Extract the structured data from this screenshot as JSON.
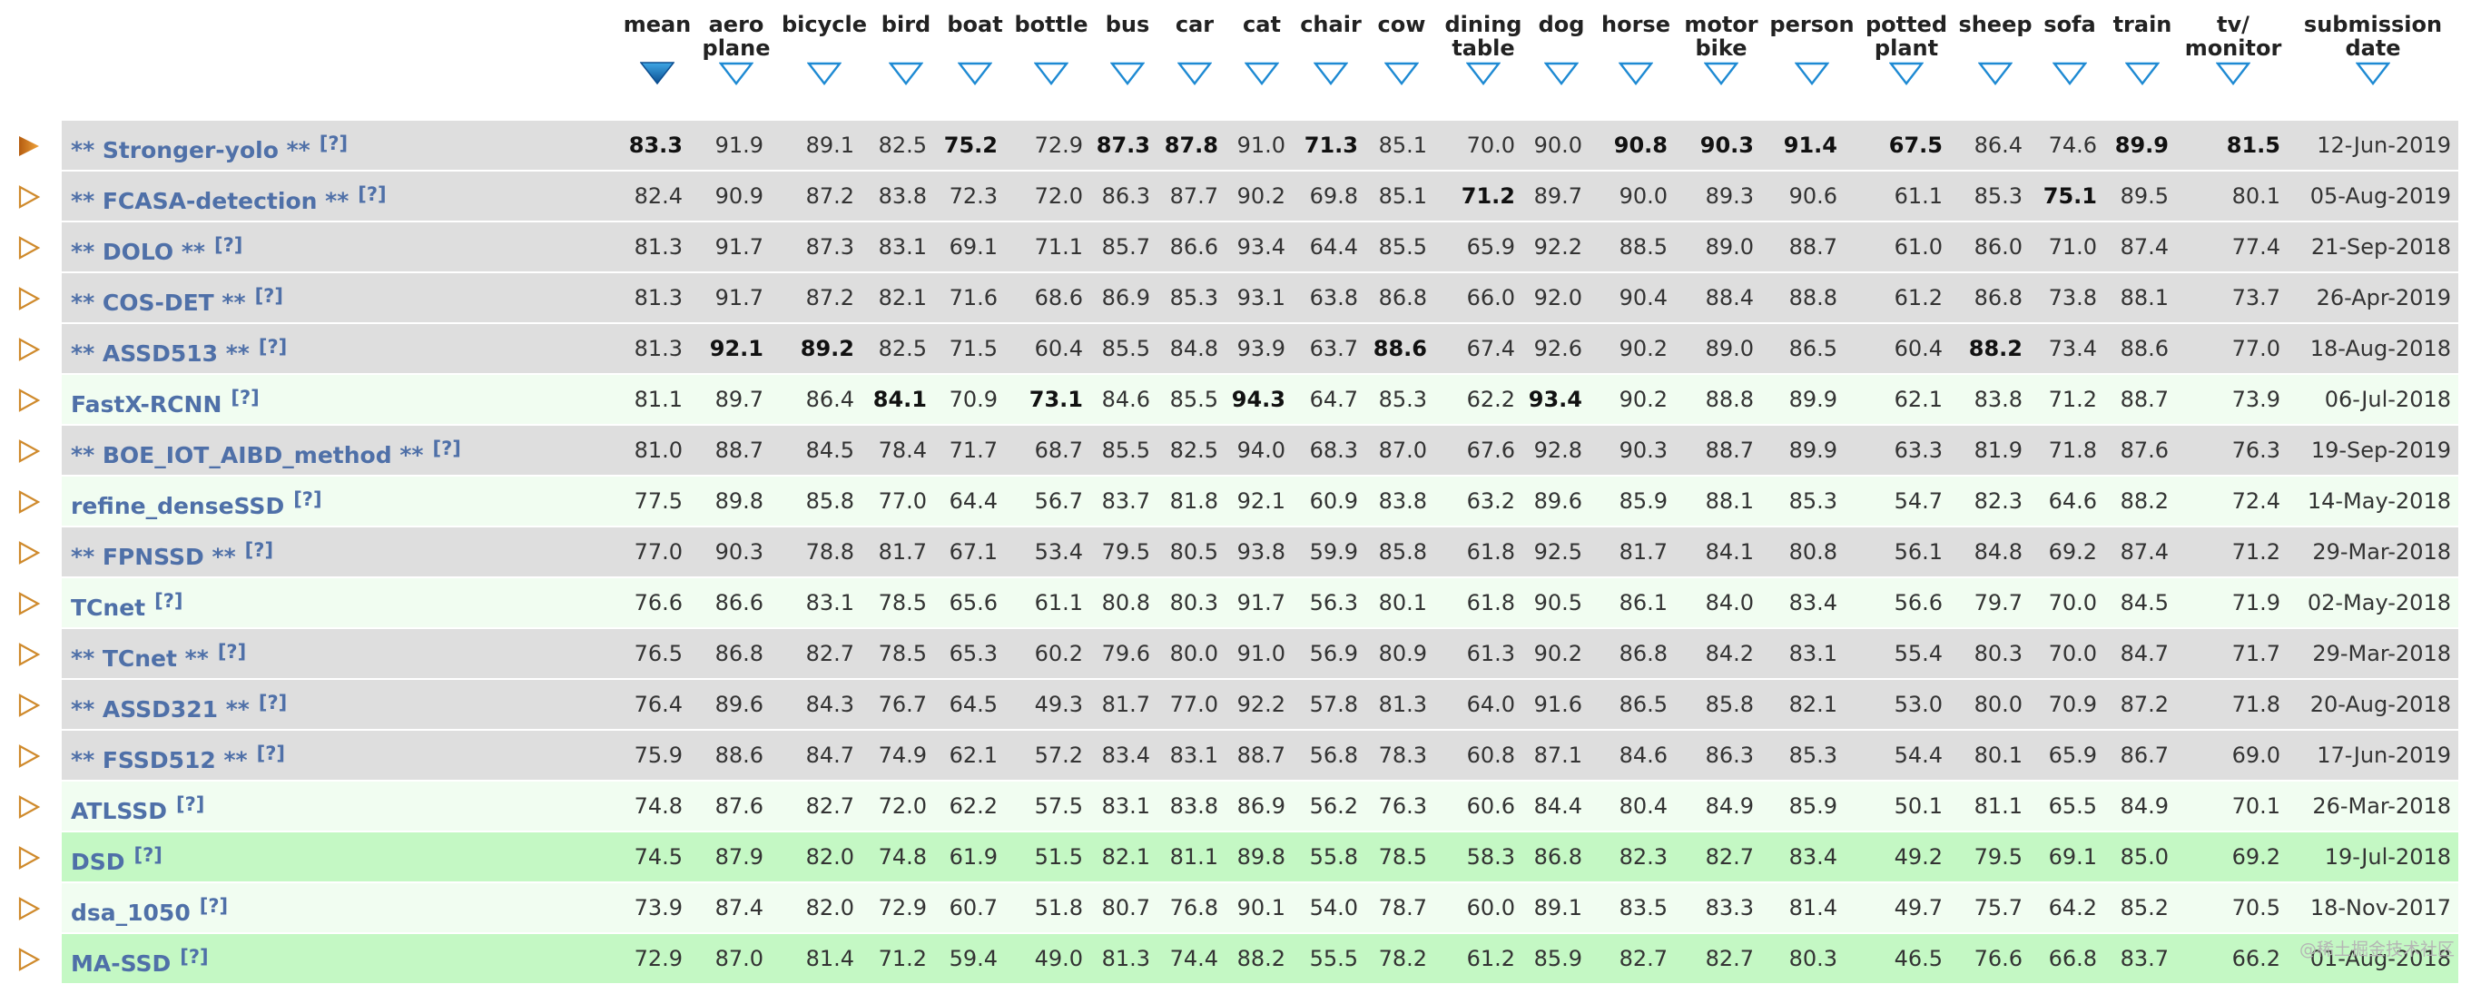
{
  "columns": [
    {
      "key": "mean",
      "label": "mean"
    },
    {
      "key": "aeroplane",
      "label": "aero\nplane"
    },
    {
      "key": "bicycle",
      "label": "bicycle"
    },
    {
      "key": "bird",
      "label": "bird"
    },
    {
      "key": "boat",
      "label": "boat"
    },
    {
      "key": "bottle",
      "label": "bottle"
    },
    {
      "key": "bus",
      "label": "bus"
    },
    {
      "key": "car",
      "label": "car"
    },
    {
      "key": "cat",
      "label": "cat"
    },
    {
      "key": "chair",
      "label": "chair"
    },
    {
      "key": "cow",
      "label": "cow"
    },
    {
      "key": "diningtable",
      "label": "dining\ntable"
    },
    {
      "key": "dog",
      "label": "dog"
    },
    {
      "key": "horse",
      "label": "horse"
    },
    {
      "key": "motorbike",
      "label": "motor\nbike"
    },
    {
      "key": "person",
      "label": "person"
    },
    {
      "key": "pottedplant",
      "label": "potted\nplant"
    },
    {
      "key": "sheep",
      "label": "sheep"
    },
    {
      "key": "sofa",
      "label": "sofa"
    },
    {
      "key": "train",
      "label": "train"
    },
    {
      "key": "tvmonitor",
      "label": "tv/\nmonitor"
    },
    {
      "key": "submission_date",
      "label": "submission\ndate"
    }
  ],
  "sort": {
    "active_column": "mean",
    "direction": "descending"
  },
  "info_link_text": "[?]",
  "colors": {
    "link": "#4f70a8",
    "row_gray": "#dedede",
    "row_pale_green": "#f1fdf1",
    "row_green": "#c4f8c4",
    "arrow_outline": "#1e8ad3",
    "expander_outline": "#cf8a2c",
    "expander_active": "#d07a16"
  },
  "rows": [
    {
      "name": "** Stronger-yolo **",
      "shade": "gray",
      "expanded": true,
      "values": [
        "83.3",
        "91.9",
        "89.1",
        "82.5",
        "75.2",
        "72.9",
        "87.3",
        "87.8",
        "91.0",
        "71.3",
        "85.1",
        "70.0",
        "90.0",
        "90.8",
        "90.3",
        "91.4",
        "67.5",
        "86.4",
        "74.6",
        "89.9",
        "81.5"
      ],
      "best": [
        0,
        4,
        6,
        7,
        9,
        13,
        14,
        15,
        16,
        19,
        20
      ],
      "date": "12-Jun-2019"
    },
    {
      "name": "** FCASA-detection **",
      "shade": "gray",
      "values": [
        "82.4",
        "90.9",
        "87.2",
        "83.8",
        "72.3",
        "72.0",
        "86.3",
        "87.7",
        "90.2",
        "69.8",
        "85.1",
        "71.2",
        "89.7",
        "90.0",
        "89.3",
        "90.6",
        "61.1",
        "85.3",
        "75.1",
        "89.5",
        "80.1"
      ],
      "best": [
        11,
        18
      ],
      "date": "05-Aug-2019"
    },
    {
      "name": "** DOLO **",
      "shade": "gray",
      "values": [
        "81.3",
        "91.7",
        "87.3",
        "83.1",
        "69.1",
        "71.1",
        "85.7",
        "86.6",
        "93.4",
        "64.4",
        "85.5",
        "65.9",
        "92.2",
        "88.5",
        "89.0",
        "88.7",
        "61.0",
        "86.0",
        "71.0",
        "87.4",
        "77.4"
      ],
      "best": [],
      "date": "21-Sep-2018"
    },
    {
      "name": "** COS-DET **",
      "shade": "gray",
      "values": [
        "81.3",
        "91.7",
        "87.2",
        "82.1",
        "71.6",
        "68.6",
        "86.9",
        "85.3",
        "93.1",
        "63.8",
        "86.8",
        "66.0",
        "92.0",
        "90.4",
        "88.4",
        "88.8",
        "61.2",
        "86.8",
        "73.8",
        "88.1",
        "73.7"
      ],
      "best": [],
      "date": "26-Apr-2019"
    },
    {
      "name": "** ASSD513 **",
      "shade": "gray",
      "values": [
        "81.3",
        "92.1",
        "89.2",
        "82.5",
        "71.5",
        "60.4",
        "85.5",
        "84.8",
        "93.9",
        "63.7",
        "88.6",
        "67.4",
        "92.6",
        "90.2",
        "89.0",
        "86.5",
        "60.4",
        "88.2",
        "73.4",
        "88.6",
        "77.0"
      ],
      "best": [
        1,
        2,
        10,
        17
      ],
      "date": "18-Aug-2018"
    },
    {
      "name": "FastX-RCNN",
      "shade": "pale",
      "values": [
        "81.1",
        "89.7",
        "86.4",
        "84.1",
        "70.9",
        "73.1",
        "84.6",
        "85.5",
        "94.3",
        "64.7",
        "85.3",
        "62.2",
        "93.4",
        "90.2",
        "88.8",
        "89.9",
        "62.1",
        "83.8",
        "71.2",
        "88.7",
        "73.9"
      ],
      "best": [
        3,
        5,
        8,
        12
      ],
      "date": "06-Jul-2018"
    },
    {
      "name": "** BOE_IOT_AIBD_method **",
      "shade": "gray",
      "values": [
        "81.0",
        "88.7",
        "84.5",
        "78.4",
        "71.7",
        "68.7",
        "85.5",
        "82.5",
        "94.0",
        "68.3",
        "87.0",
        "67.6",
        "92.8",
        "90.3",
        "88.7",
        "89.9",
        "63.3",
        "81.9",
        "71.8",
        "87.6",
        "76.3"
      ],
      "best": [],
      "date": "19-Sep-2019"
    },
    {
      "name": "refine_denseSSD",
      "shade": "pale",
      "values": [
        "77.5",
        "89.8",
        "85.8",
        "77.0",
        "64.4",
        "56.7",
        "83.7",
        "81.8",
        "92.1",
        "60.9",
        "83.8",
        "63.2",
        "89.6",
        "85.9",
        "88.1",
        "85.3",
        "54.7",
        "82.3",
        "64.6",
        "88.2",
        "72.4"
      ],
      "best": [],
      "date": "14-May-2018"
    },
    {
      "name": "** FPNSSD **",
      "shade": "gray",
      "values": [
        "77.0",
        "90.3",
        "78.8",
        "81.7",
        "67.1",
        "53.4",
        "79.5",
        "80.5",
        "93.8",
        "59.9",
        "85.8",
        "61.8",
        "92.5",
        "81.7",
        "84.1",
        "80.8",
        "56.1",
        "84.8",
        "69.2",
        "87.4",
        "71.2"
      ],
      "best": [],
      "date": "29-Mar-2018"
    },
    {
      "name": "TCnet",
      "shade": "pale",
      "values": [
        "76.6",
        "86.6",
        "83.1",
        "78.5",
        "65.6",
        "61.1",
        "80.8",
        "80.3",
        "91.7",
        "56.3",
        "80.1",
        "61.8",
        "90.5",
        "86.1",
        "84.0",
        "83.4",
        "56.6",
        "79.7",
        "70.0",
        "84.5",
        "71.9"
      ],
      "best": [],
      "date": "02-May-2018"
    },
    {
      "name": "** TCnet **",
      "shade": "gray",
      "values": [
        "76.5",
        "86.8",
        "82.7",
        "78.5",
        "65.3",
        "60.2",
        "79.6",
        "80.0",
        "91.0",
        "56.9",
        "80.9",
        "61.3",
        "90.2",
        "86.8",
        "84.2",
        "83.1",
        "55.4",
        "80.3",
        "70.0",
        "84.7",
        "71.7"
      ],
      "best": [],
      "date": "29-Mar-2018"
    },
    {
      "name": "** ASSD321 **",
      "shade": "gray",
      "values": [
        "76.4",
        "89.6",
        "84.3",
        "76.7",
        "64.5",
        "49.3",
        "81.7",
        "77.0",
        "92.2",
        "57.8",
        "81.3",
        "64.0",
        "91.6",
        "86.5",
        "85.8",
        "82.1",
        "53.0",
        "80.0",
        "70.9",
        "87.2",
        "71.8"
      ],
      "best": [],
      "date": "20-Aug-2018"
    },
    {
      "name": "** FSSD512 **",
      "shade": "gray",
      "values": [
        "75.9",
        "88.6",
        "84.7",
        "74.9",
        "62.1",
        "57.2",
        "83.4",
        "83.1",
        "88.7",
        "56.8",
        "78.3",
        "60.8",
        "87.1",
        "84.6",
        "86.3",
        "85.3",
        "54.4",
        "80.1",
        "65.9",
        "86.7",
        "69.0"
      ],
      "best": [],
      "date": "17-Jun-2019"
    },
    {
      "name": "ATLSSD",
      "shade": "pale",
      "values": [
        "74.8",
        "87.6",
        "82.7",
        "72.0",
        "62.2",
        "57.5",
        "83.1",
        "83.8",
        "86.9",
        "56.2",
        "76.3",
        "60.6",
        "84.4",
        "80.4",
        "84.9",
        "85.9",
        "50.1",
        "81.1",
        "65.5",
        "84.9",
        "70.1"
      ],
      "best": [],
      "date": "26-Mar-2018"
    },
    {
      "name": "DSD",
      "shade": "green",
      "values": [
        "74.5",
        "87.9",
        "82.0",
        "74.8",
        "61.9",
        "51.5",
        "82.1",
        "81.1",
        "89.8",
        "55.8",
        "78.5",
        "58.3",
        "86.8",
        "82.3",
        "82.7",
        "83.4",
        "49.2",
        "79.5",
        "69.1",
        "85.0",
        "69.2"
      ],
      "best": [],
      "date": "19-Jul-2018"
    },
    {
      "name": "dsa_1050",
      "shade": "pale",
      "values": [
        "73.9",
        "87.4",
        "82.0",
        "72.9",
        "60.7",
        "51.8",
        "80.7",
        "76.8",
        "90.1",
        "54.0",
        "78.7",
        "60.0",
        "89.1",
        "83.5",
        "83.3",
        "81.4",
        "49.7",
        "75.7",
        "64.2",
        "85.2",
        "70.5"
      ],
      "best": [],
      "date": "18-Nov-2017"
    },
    {
      "name": "MA-SSD",
      "shade": "green",
      "values": [
        "72.9",
        "87.0",
        "81.4",
        "71.2",
        "59.4",
        "49.0",
        "81.3",
        "74.4",
        "88.2",
        "55.5",
        "78.2",
        "61.2",
        "85.9",
        "82.7",
        "82.7",
        "80.3",
        "46.5",
        "76.6",
        "66.8",
        "83.7",
        "66.2"
      ],
      "best": [],
      "date": "01-Aug-2018"
    }
  ],
  "watermark": "@稀土掘金技术社区"
}
